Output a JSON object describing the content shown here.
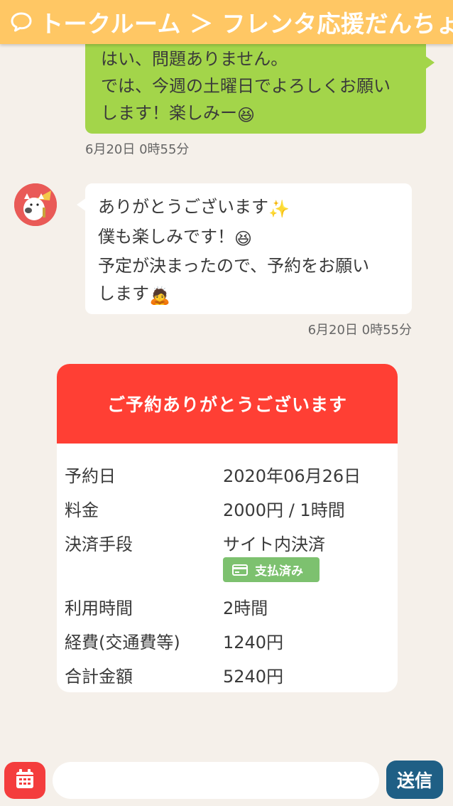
{
  "header": {
    "title": "トークルーム ＞ フレンタ応援だんちょ",
    "chat_icon": "speech-bubble-icon"
  },
  "messages": [
    {
      "side": "mine",
      "lines": [
        "はい、問題ありません。",
        "では、今週の土曜日でよろしくお願い",
        "します！楽しみー"
      ],
      "emoji": "😆",
      "time": "6月20日 0時55分"
    },
    {
      "side": "other",
      "lines": [
        "ありがとうございます",
        "僕も楽しみです！",
        "予定が決まったので、予約をお願い",
        "します"
      ],
      "emojis": [
        "✨",
        "😆",
        "🙇"
      ],
      "time": "6月20日 0時55分"
    }
  ],
  "reservation": {
    "title": "ご予約ありがとうございます",
    "rows": [
      {
        "label": "予約日",
        "value": "2020年06月26日"
      },
      {
        "label": "料金",
        "value": "2000円 / 1時間"
      },
      {
        "label": "決済手段",
        "value": "サイト内決済"
      },
      {
        "label": "利用時間",
        "value": "2時間"
      },
      {
        "label": "経費(交通費等)",
        "value": "1240円"
      },
      {
        "label": "合計金額",
        "value": "5240円"
      }
    ],
    "paid_badge": "支払済み"
  },
  "footer": {
    "calendar_icon": "calendar-icon",
    "input_placeholder": "",
    "send_label": "送信"
  },
  "colors": {
    "header": "#ffc764",
    "my_bubble": "#a3d54a",
    "card_header": "#ff3f34",
    "paid_badge": "#7dc16f",
    "send_button": "#1f5f85",
    "calendar_button": "#f43d3d"
  }
}
